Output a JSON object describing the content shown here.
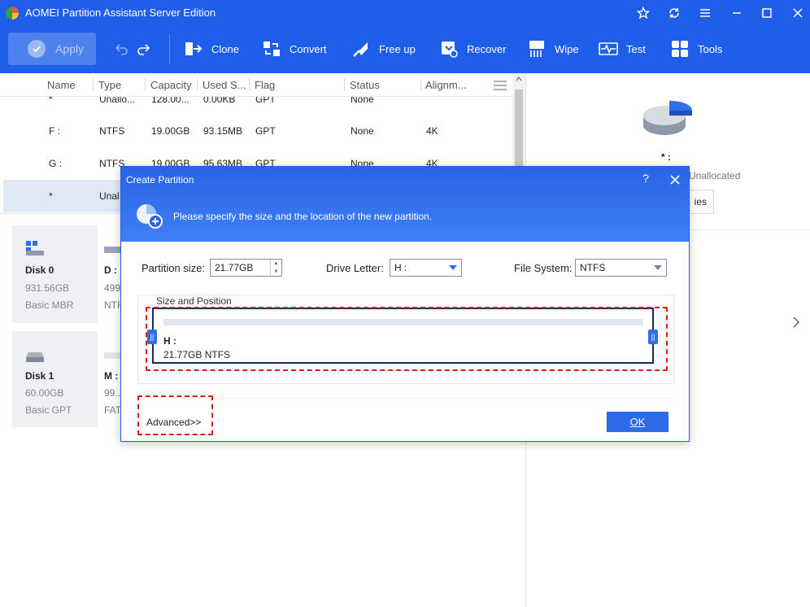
{
  "window": {
    "title": "AOMEI Partition Assistant Server Edition"
  },
  "toolbar": {
    "apply_label": "Apply",
    "tools": [
      {
        "label": "Clone",
        "icon": "clone-icon"
      },
      {
        "label": "Convert",
        "icon": "convert-icon"
      },
      {
        "label": "Free up",
        "icon": "free-up-icon"
      },
      {
        "label": "Recover",
        "icon": "recover-icon"
      },
      {
        "label": "Wipe",
        "icon": "wipe-icon"
      },
      {
        "label": "Test",
        "icon": "test-icon"
      },
      {
        "label": "Tools",
        "icon": "tools-icon"
      }
    ]
  },
  "table": {
    "columns": [
      "Name",
      "Type",
      "Capacity",
      "Used S...",
      "Flag",
      "Status",
      "Alignm..."
    ],
    "rows": [
      {
        "name": "*",
        "type": "Unallo...",
        "capacity": "128.00...",
        "used": "0.00KB",
        "flag": "GPT",
        "status": "None",
        "align": ""
      },
      {
        "name": "F :",
        "type": "NTFS",
        "capacity": "19.00GB",
        "used": "93.15MB",
        "flag": "GPT",
        "status": "None",
        "align": "4K"
      },
      {
        "name": "G :",
        "type": "NTFS",
        "capacity": "19.00GB",
        "used": "95.63MB",
        "flag": "GPT",
        "status": "None",
        "align": "4K"
      },
      {
        "name": "*",
        "type": "Unal",
        "capacity": "",
        "used": "",
        "flag": "",
        "status": "",
        "align": ""
      }
    ]
  },
  "disks": [
    {
      "name": "Disk 0",
      "size": "931.56GB",
      "type": "Basic MBR",
      "partition_label": "D :",
      "partition_sub1": "499",
      "partition_sub2": "NTF"
    },
    {
      "name": "Disk 1",
      "size": "60.00GB",
      "type": "Basic GPT",
      "partition_label": "M :",
      "partition_sub1": "99...",
      "partition_sub2": "FAT"
    }
  ],
  "right_panel": {
    "star": "* :",
    "unallocated": "Unallocated",
    "properties_fragment": "ies"
  },
  "dialog": {
    "title": "Create Partition",
    "help": "?",
    "message": "Please specify the size and the location of the new partition.",
    "partition_size_label": "Partition size:",
    "partition_size_value": "21.77GB",
    "drive_letter_label": "Drive Letter:",
    "drive_letter_value": "H :",
    "file_system_label": "File System:",
    "file_system_value": "NTFS",
    "group_title": "Size and Position",
    "partition_letter": "H :",
    "partition_summary": "21.77GB NTFS",
    "advanced_label": "Advanced>>",
    "ok_label": "OK"
  },
  "colors": {
    "brand_blue": "#1f5ee8",
    "highlight_red": "#e01a1a"
  }
}
